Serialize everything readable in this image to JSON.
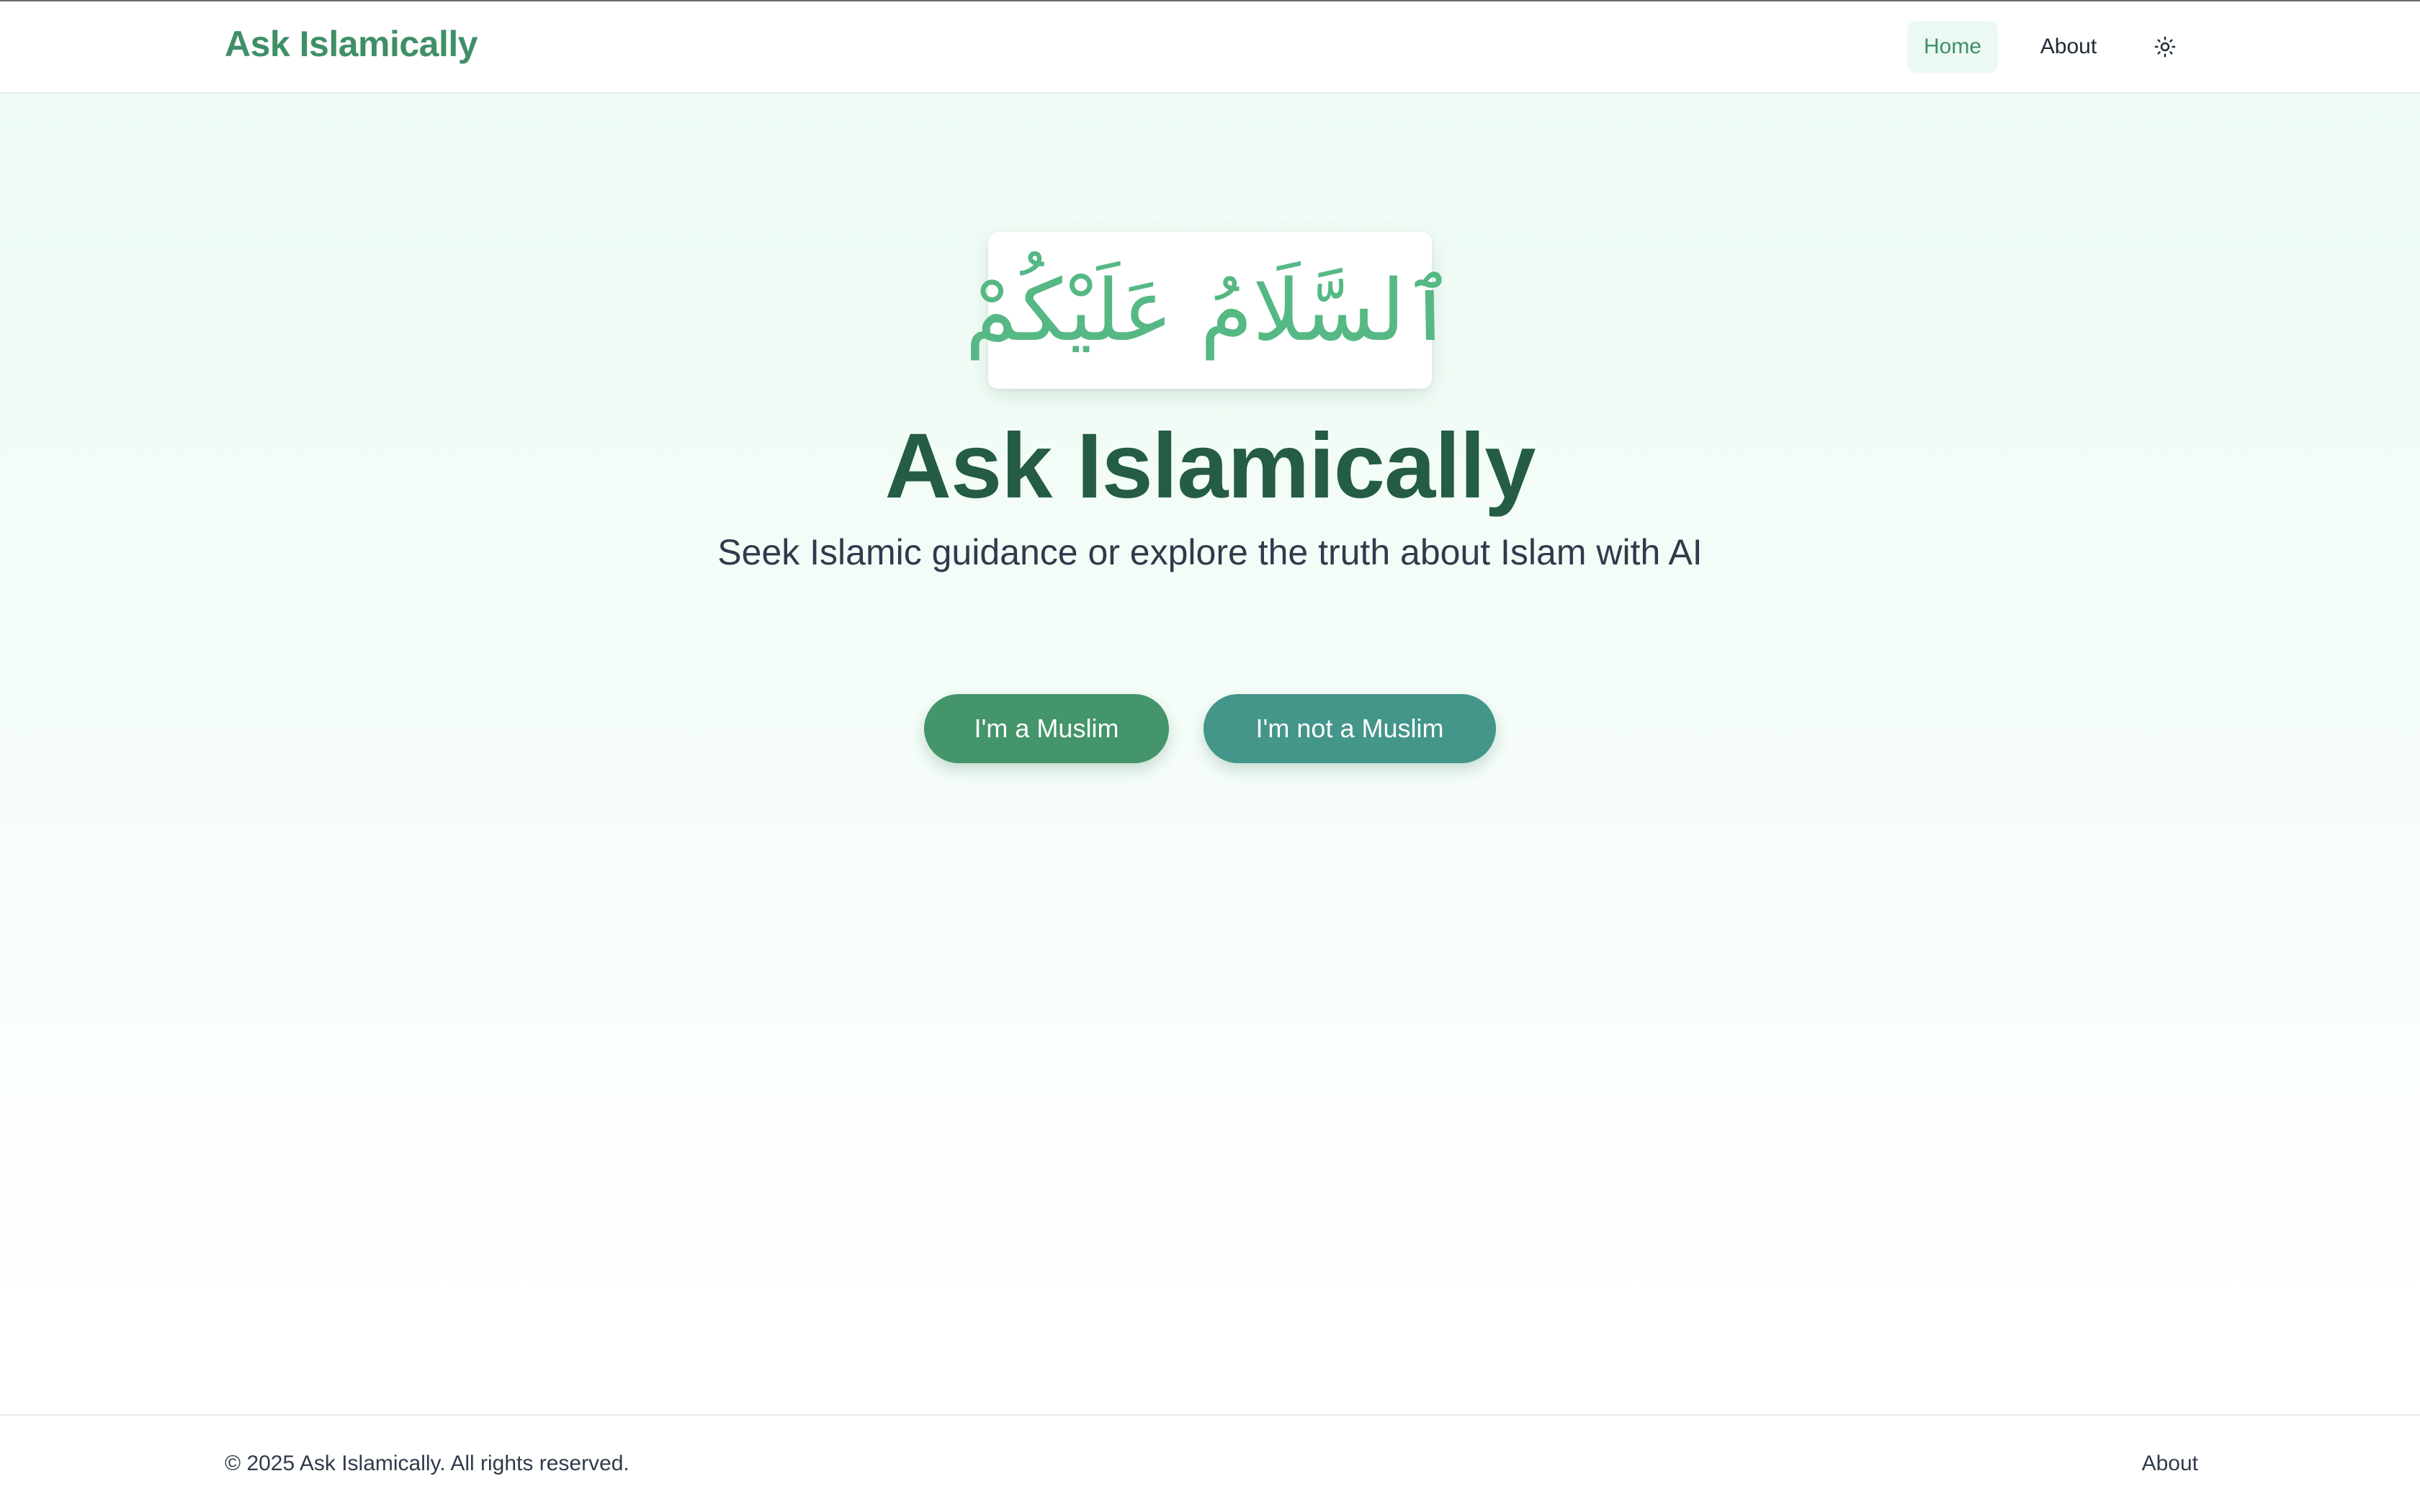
{
  "header": {
    "brand": "Ask Islamically",
    "nav": {
      "home": "Home",
      "about": "About"
    },
    "theme_icon": "sun-icon"
  },
  "hero": {
    "greeting_arabic": "ٱلسَّلَامُ عَلَيْكُمْ",
    "title": "Ask Islamically",
    "subtitle": "Seek Islamic guidance or explore the truth about Islam with AI",
    "buttons": {
      "muslim": "I'm a Muslim",
      "not_muslim": "I'm not a Muslim"
    }
  },
  "footer": {
    "copyright": "© 2025 Ask Islamically. All rights reserved.",
    "about": "About"
  },
  "colors": {
    "brand_green": "#3f8f66",
    "title_green": "#245c44",
    "arabic_green": "#56b884",
    "button_muslim": "#44956a",
    "button_not_muslim": "#44958a",
    "nav_active_bg": "#ecf9f2"
  }
}
